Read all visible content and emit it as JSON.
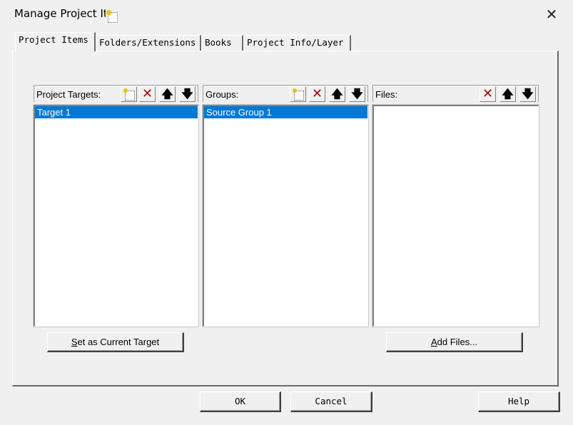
{
  "window": {
    "title": "Manage Project Iter",
    "close_glyph": "✕"
  },
  "tabs": [
    {
      "label": "Project Items",
      "active": true
    },
    {
      "label": "Folders/Extensions",
      "active": false
    },
    {
      "label": "Books",
      "active": false
    },
    {
      "label": "Project Info/Layer",
      "active": false
    }
  ],
  "targets": {
    "label": "Project Targets:",
    "items": [
      "Target 1"
    ],
    "selected_index": 0
  },
  "groups": {
    "label": "Groups:",
    "items": [
      "Source Group 1"
    ],
    "selected_index": 0
  },
  "files": {
    "label": "Files:",
    "items": []
  },
  "toolbar_glyphs": {
    "delete": "✕",
    "up": "🡅",
    "down": "🡇"
  },
  "buttons": {
    "set_current_target": {
      "accel": "S",
      "rest": "et as Current Target"
    },
    "add_files": {
      "accel": "A",
      "rest": "dd Files..."
    },
    "ok": "OK",
    "cancel": "Cancel",
    "help": "Help"
  },
  "colors": {
    "selection": "#0078d7",
    "delete_icon": "#b00000"
  }
}
